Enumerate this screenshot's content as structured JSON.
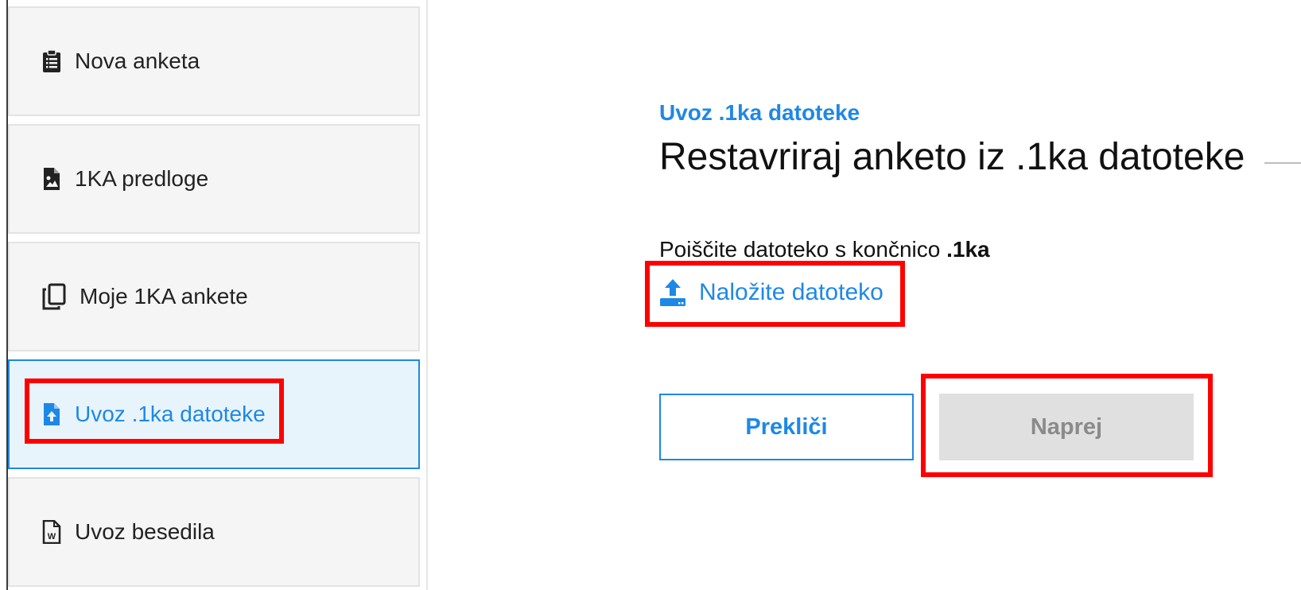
{
  "sidebar": {
    "items": [
      {
        "label": "Nova anketa",
        "icon": "clipboard-list-icon"
      },
      {
        "label": "1KA predloge",
        "icon": "file-image-icon"
      },
      {
        "label": "Moje 1KA ankete",
        "icon": "copy-icon"
      },
      {
        "label": "Uvoz .1ka datoteke",
        "icon": "file-upload-icon",
        "active": true
      },
      {
        "label": "Uvoz besedila",
        "icon": "file-word-icon"
      }
    ]
  },
  "main": {
    "kicker": "Uvoz .1ka datoteke",
    "title": "Restavriraj anketo iz .1ka datoteke",
    "hint_text": "Poiščite datoteko s končnico",
    "hint_ext": ".1ka",
    "upload_label": "Naložite datoteko",
    "upload_icon": "upload-icon",
    "cancel_label": "Prekliči",
    "next_label": "Naprej"
  },
  "colors": {
    "accent": "#1e88e5",
    "highlight": "#ff0000",
    "disabled_bg": "#e0e0e0"
  }
}
